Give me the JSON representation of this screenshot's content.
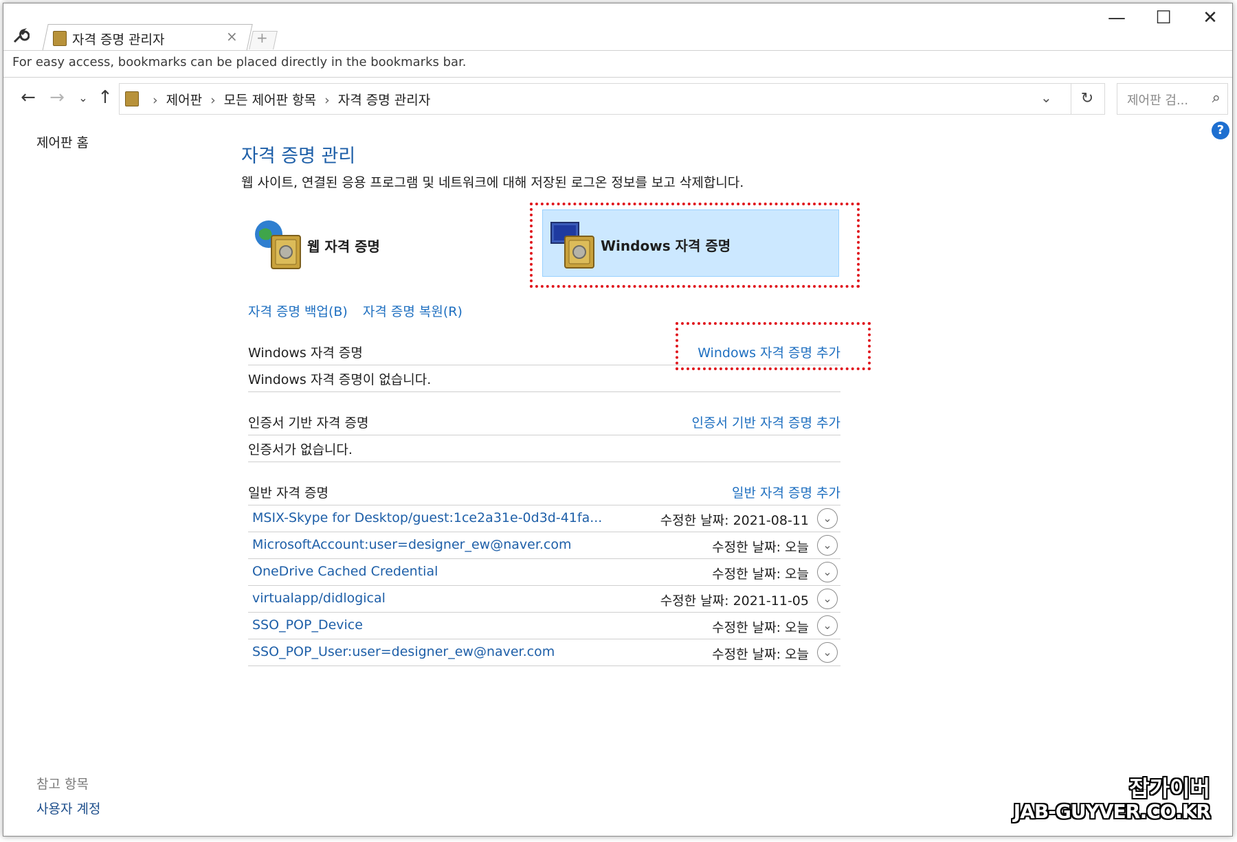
{
  "browser": {
    "tab_title": "자격 증명 관리자",
    "bookmarks_bar_text": "For easy access, bookmarks can be placed directly in the bookmarks bar."
  },
  "address_bar": {
    "breadcrumbs": [
      "제어판",
      "모든 제어판 항목",
      "자격 증명 관리자"
    ],
    "search_placeholder": "제어판 검..."
  },
  "left_nav": {
    "home": "제어판 홈",
    "see_also": "참고 항목",
    "user_accounts": "사용자 계정"
  },
  "main": {
    "title": "자격 증명 관리",
    "description": "웹 사이트, 연결된 응용 프로그램 및 네트워크에 대해 저장된 로그온 정보를 보고 삭제합니다.",
    "tiles": {
      "web": "웹 자격 증명",
      "windows": "Windows 자격 증명"
    },
    "backup_link": "자격 증명 백업(B)",
    "restore_link": "자격 증명 복원(R)",
    "windows_section": {
      "title": "Windows 자격 증명",
      "add": "Windows 자격 증명 추가",
      "empty": "Windows 자격 증명이 없습니다."
    },
    "cert_section": {
      "title": "인증서 기반 자격 증명",
      "add": "인증서 기반 자격 증명 추가",
      "empty": "인증서가 없습니다."
    },
    "generic_section": {
      "title": "일반 자격 증명",
      "add": "일반 자격 증명 추가",
      "items": [
        {
          "name": "MSIX-Skype for Desktop/guest:1ce2a31e-0d3d-41fa...",
          "modified": "수정한 날짜:  2021-08-11"
        },
        {
          "name": "MicrosoftAccount:user=designer_ew@naver.com",
          "modified": "수정한 날짜:  오늘"
        },
        {
          "name": "OneDrive Cached Credential",
          "modified": "수정한 날짜:  오늘"
        },
        {
          "name": "virtualapp/didlogical",
          "modified": "수정한 날짜:  2021-11-05"
        },
        {
          "name": "SSO_POP_Device",
          "modified": "수정한 날짜:  오늘"
        },
        {
          "name": "SSO_POP_User:user=designer_ew@naver.com",
          "modified": "수정한 날짜:  오늘"
        }
      ]
    }
  },
  "watermark": {
    "line1": "잡가이버",
    "line2": "JAB-GUYVER.CO.KR"
  },
  "colors": {
    "link": "#1e6fc0",
    "title": "#1e5fa8",
    "selected_tile_bg": "#cce8ff",
    "highlight_box": "#e0161d"
  }
}
